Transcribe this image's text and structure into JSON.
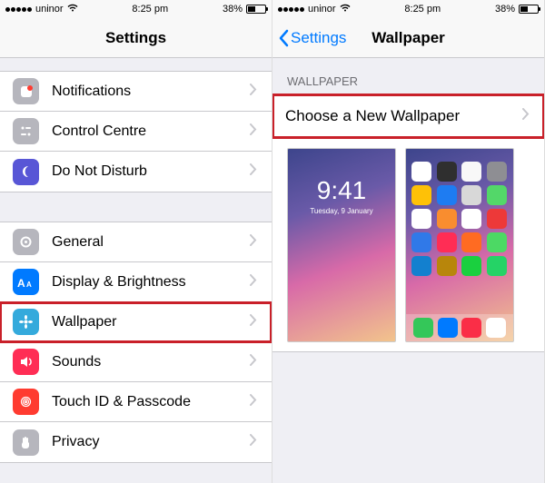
{
  "status": {
    "carrier": "uninor",
    "time": "8:25 pm",
    "battery_pct": "38%"
  },
  "left": {
    "title": "Settings",
    "group1": [
      {
        "key": "notifications",
        "label": "Notifications"
      },
      {
        "key": "control-centre",
        "label": "Control Centre"
      },
      {
        "key": "do-not-disturb",
        "label": "Do Not Disturb"
      }
    ],
    "group2": [
      {
        "key": "general",
        "label": "General"
      },
      {
        "key": "display-brightness",
        "label": "Display & Brightness"
      },
      {
        "key": "wallpaper",
        "label": "Wallpaper",
        "highlighted": true
      },
      {
        "key": "sounds",
        "label": "Sounds"
      },
      {
        "key": "touchid-passcode",
        "label": "Touch ID & Passcode"
      },
      {
        "key": "privacy",
        "label": "Privacy"
      }
    ]
  },
  "right": {
    "back_label": "Settings",
    "title": "Wallpaper",
    "section_header": "WALLPAPER",
    "choose_label": "Choose a New Wallpaper",
    "lock_preview": {
      "time": "9:41",
      "date": "Tuesday, 9 January"
    }
  }
}
